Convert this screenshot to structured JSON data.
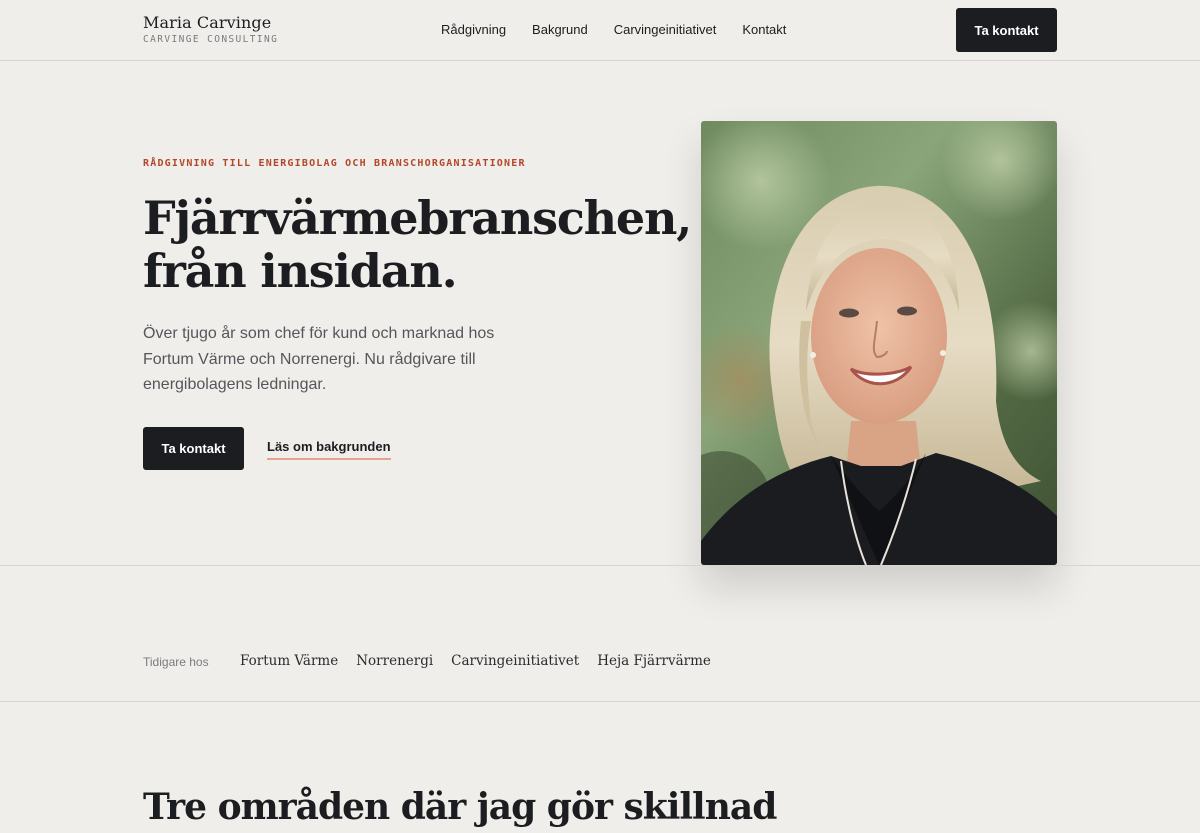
{
  "header": {
    "brand_name": "Maria Carvinge",
    "brand_sub": "CARVINGE CONSULTING",
    "nav": [
      "Rådgivning",
      "Bakgrund",
      "Carvingeinitiativet",
      "Kontakt"
    ],
    "cta": "Ta kontakt"
  },
  "hero": {
    "eyebrow": "RÅDGIVNING TILL ENERGIBOLAG OCH BRANSCHORGANISATIONER",
    "title_line1": "Fjärrvärmebranschen,",
    "title_line2": "från insidan.",
    "lead": "Över tjugo år som chef för kund och marknad hos Fortum Värme och Norrenergi. Nu rådgivare till energibolagens ledningar.",
    "primary_button": "Ta kontakt",
    "secondary_link": "Läs om bakgrunden"
  },
  "previously": {
    "label": "Tidigare hos",
    "companies": [
      "Fortum Värme",
      "Norrenergi",
      "Carvingeinitiativet",
      "Heja Fjärrvärme"
    ]
  },
  "section": {
    "title": "Tre områden där jag gör skillnad"
  },
  "colors": {
    "background": "#f0eeea",
    "ink": "#1c1d20",
    "accent": "#b4472a",
    "underline": "#e2a491"
  }
}
